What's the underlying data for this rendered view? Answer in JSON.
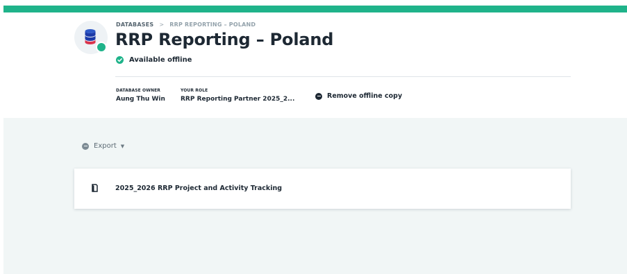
{
  "colors": {
    "accent": "#1fb38a",
    "text_dark": "#1d2833",
    "background_content": "#f1f6f6",
    "breadcrumb_muted": "#93a2ab"
  },
  "breadcrumb": {
    "first": "DATABASES",
    "separator": ">",
    "current": "RRP REPORTING – POLAND"
  },
  "page": {
    "title": "RRP Reporting – Poland",
    "icon": "database-icon",
    "status_badge_icon": "online-dot-icon"
  },
  "offline_status": {
    "icon": "check-circle-icon",
    "label": "Available offline"
  },
  "meta": {
    "owner_label": "DATABASE OWNER",
    "owner_value": "Aung Thu Win",
    "role_label": "YOUR ROLE",
    "role_value": "RRP Reporting Partner 2025_2..."
  },
  "actions": {
    "remove_offline_label": "Remove offline copy",
    "remove_offline_icon": "minus-circle-icon"
  },
  "toolbar": {
    "export_label": "Export",
    "export_icon": "export-icon",
    "export_caret": "▼"
  },
  "items": [
    {
      "label": "2025_2026 RRP Project and Activity Tracking",
      "icon": "document-icon"
    }
  ]
}
